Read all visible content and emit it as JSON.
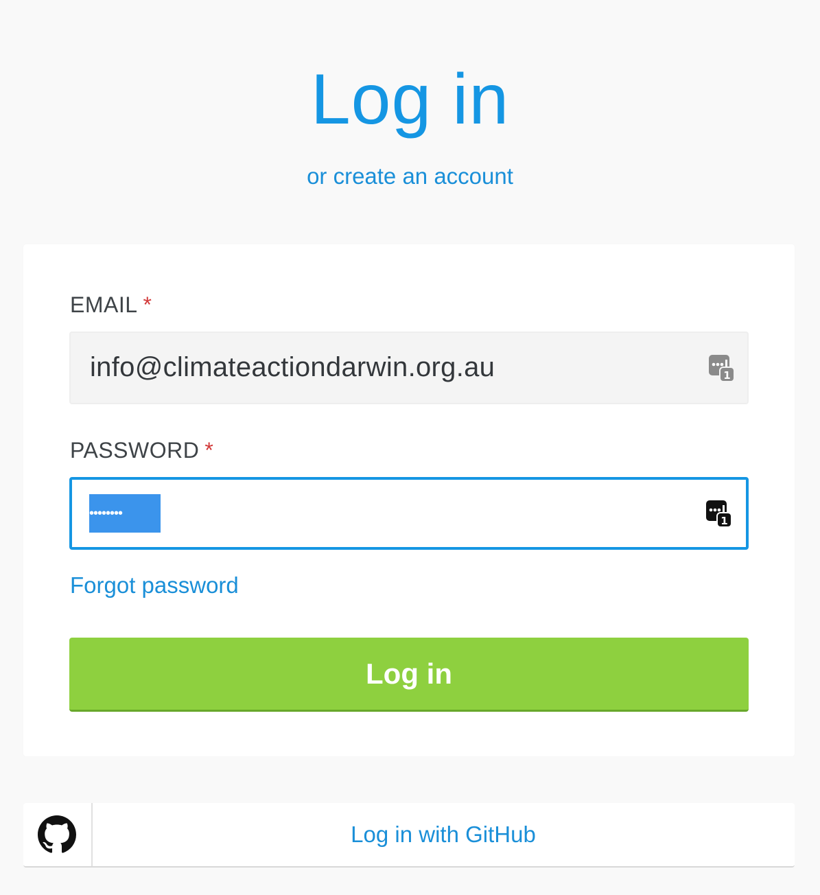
{
  "header": {
    "title": "Log in",
    "create_account_link": "or create an account"
  },
  "form": {
    "email": {
      "label": "EMAIL",
      "required_marker": "*",
      "value": "info@climateactiondarwin.org.au"
    },
    "password": {
      "label": "PASSWORD",
      "required_marker": "*",
      "masked_value": "••••••••"
    },
    "forgot_password_link": "Forgot password",
    "submit_label": "Log in"
  },
  "github": {
    "label": "Log in with GitHub",
    "icon": "github-icon"
  },
  "icons": {
    "password_manager": "password-manager-icon"
  },
  "colors": {
    "accent": "#1596e3",
    "submit": "#8ed03f",
    "required": "#d23a3a",
    "selection": "#3b94ec"
  }
}
